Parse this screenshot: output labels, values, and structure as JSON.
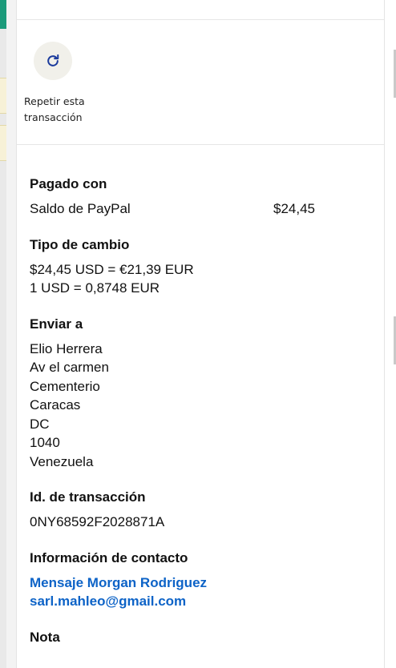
{
  "actions": {
    "repeat_label": "Repetir esta transacción"
  },
  "paid_with": {
    "heading": "Pagado con",
    "method": "Saldo de PayPal",
    "amount": "$24,45"
  },
  "exchange": {
    "heading": "Tipo de cambio",
    "line1": "$24,45 USD = €21,39 EUR",
    "line2": "1 USD = 0,8748 EUR"
  },
  "ship_to": {
    "heading": "Enviar a",
    "lines": [
      "Elio Herrera",
      "Av el carmen",
      "Cementerio",
      "Caracas",
      "DC",
      "1040",
      "Venezuela"
    ]
  },
  "transaction": {
    "heading": "Id. de transacción",
    "id": "0NY68592F2028871A"
  },
  "contact": {
    "heading": "Información de contacto",
    "message_link": "Mensaje Morgan Rodriguez",
    "email": "sarl.mahleo@gmail.com"
  },
  "note": {
    "heading": "Nota"
  },
  "colors": {
    "link": "#0d63c7",
    "icon": "#1a3a9c",
    "icon_bg": "#f1f0ea"
  },
  "icons": {
    "repeat": "refresh-icon"
  }
}
